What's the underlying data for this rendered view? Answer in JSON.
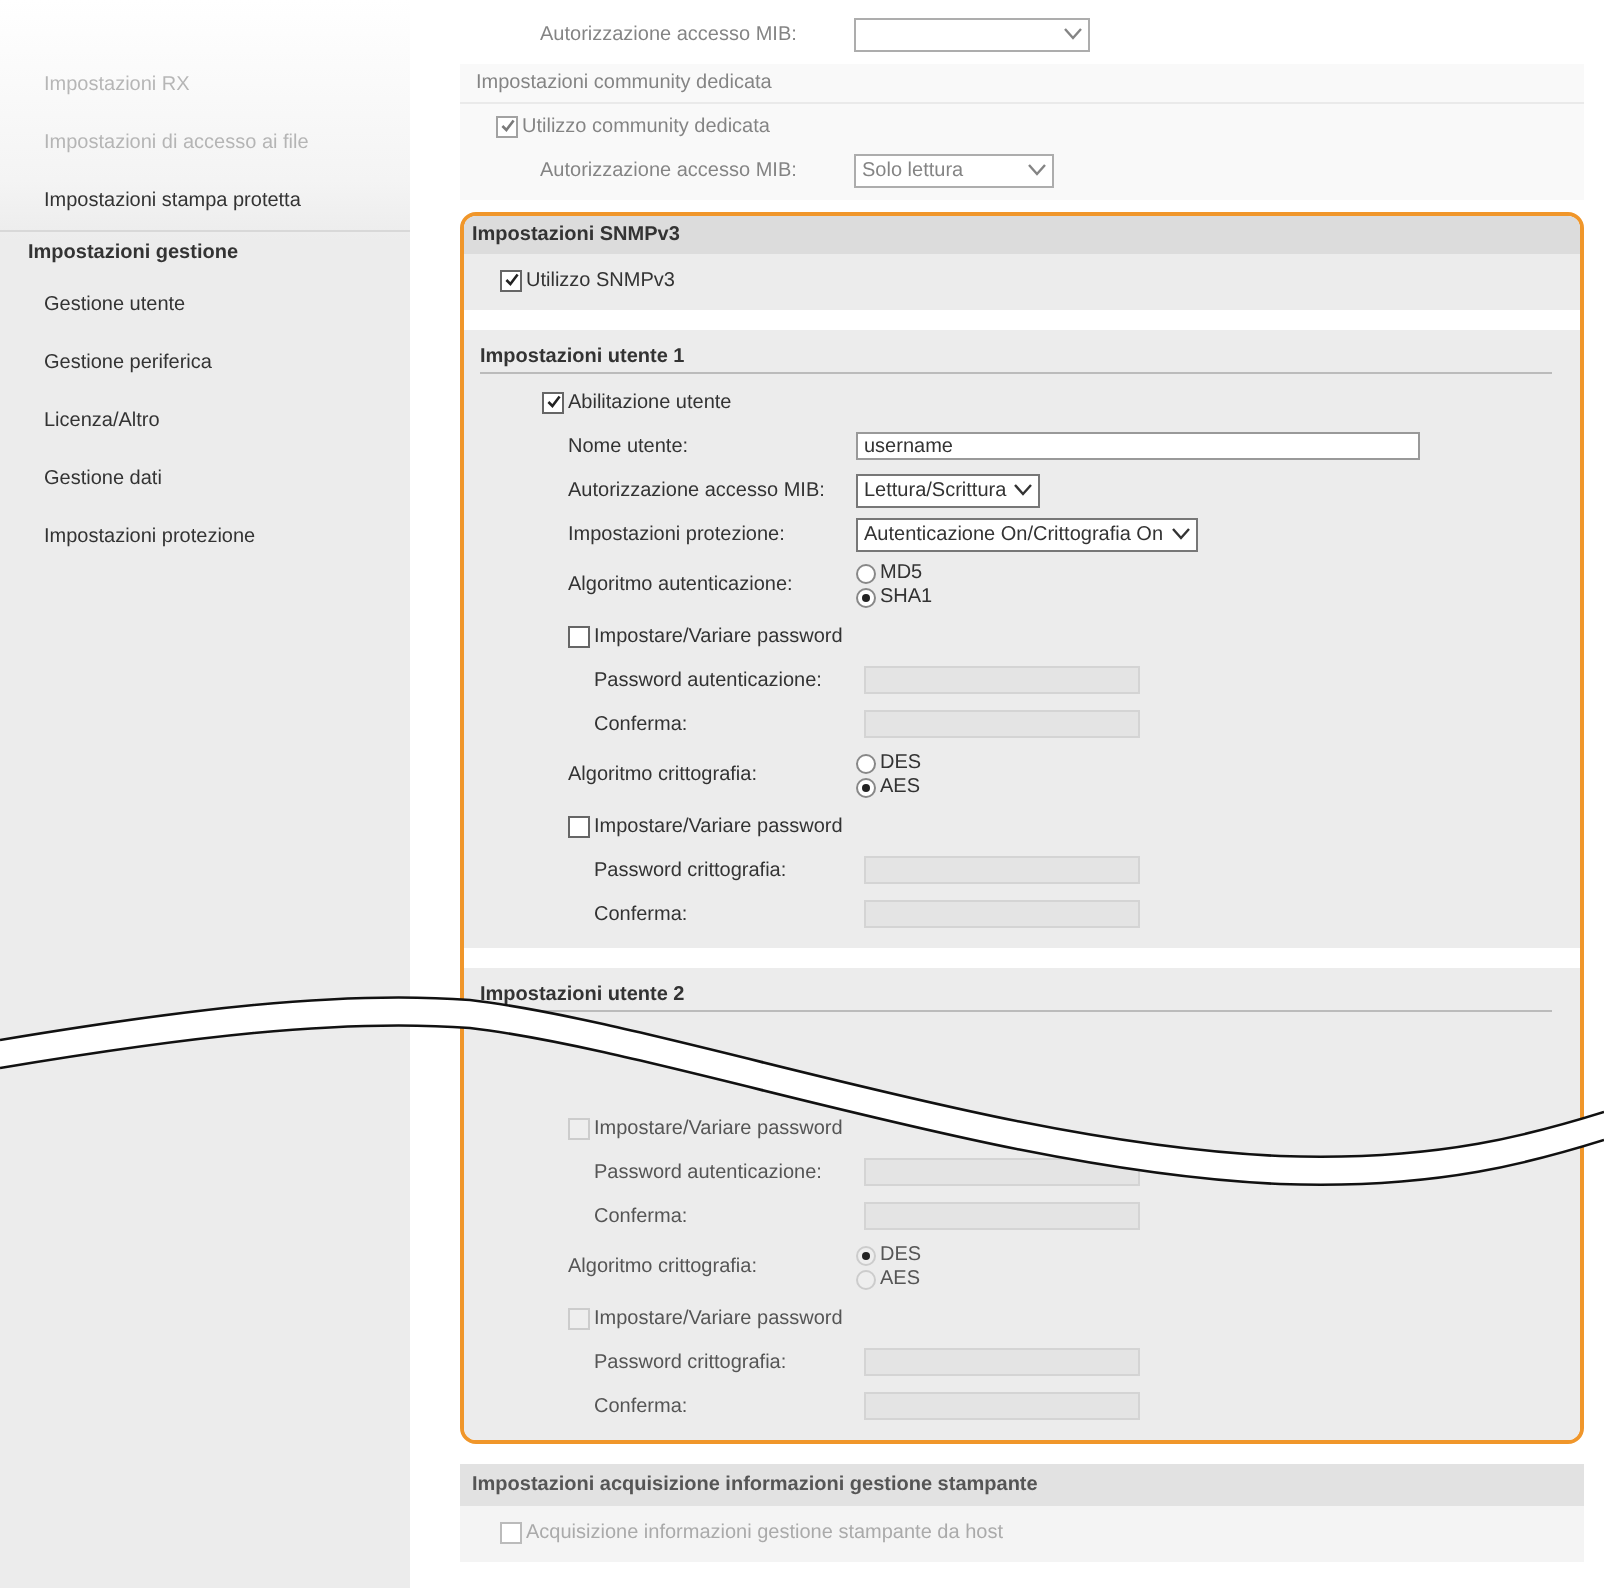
{
  "sidebar": {
    "items": [
      {
        "label": "Impostazioni RX",
        "kind": "item",
        "faded": true
      },
      {
        "label": "Impostazioni di accesso ai file",
        "kind": "item",
        "faded": true
      },
      {
        "label": "Impostazioni stampa protetta",
        "kind": "item",
        "faded": false
      },
      {
        "label": "Impostazioni gestione",
        "kind": "header",
        "faded": false
      },
      {
        "label": "Gestione utente",
        "kind": "item",
        "faded": false
      },
      {
        "label": "Gestione periferica",
        "kind": "item",
        "faded": false
      },
      {
        "label": "Licenza/Altro",
        "kind": "item",
        "faded": false
      },
      {
        "label": "Gestione dati",
        "kind": "item",
        "faded": false
      },
      {
        "label": "Impostazioni protezione",
        "kind": "item",
        "faded": false
      }
    ]
  },
  "snmpv1": {
    "faded": true,
    "mib_label": "Autorizzazione accesso MIB:",
    "community": {
      "title": "Impostazioni community dedicata",
      "checkbox": {
        "label": "Utilizzo community dedicata",
        "checked": true
      },
      "mib": {
        "label": "Autorizzazione accesso MIB:",
        "value": "Solo lettura"
      }
    }
  },
  "snmpv3": {
    "title": "Impostazioni SNMPv3",
    "checkbox": {
      "label": "Utilizzo SNMPv3",
      "checked": true
    },
    "users": [
      {
        "title": "Impostazioni utente 1",
        "disabled": false,
        "cut": false,
        "rows": [
          {
            "kind": "checkbox",
            "label": "Abilitazione utente",
            "checked": true,
            "children": [
              {
                "kind": "text",
                "label": "Nome utente:",
                "value": "username"
              },
              {
                "kind": "select",
                "label": "Autorizzazione accesso MIB:",
                "value": "Lettura/Scrittura"
              },
              {
                "kind": "select",
                "label": "Impostazioni protezione:",
                "value": "Autenticazione On/Crittografia On"
              },
              {
                "kind": "radio",
                "label": "Algoritmo autenticazione:",
                "options": [
                  {
                    "label": "MD5",
                    "selected": false
                  },
                  {
                    "label": "SHA1",
                    "selected": true
                  }
                ]
              },
              {
                "kind": "checkbox",
                "label": "Impostare/Variare password",
                "checked": false,
                "children": [
                  {
                    "kind": "password",
                    "label": "Password autenticazione:"
                  },
                  {
                    "kind": "password",
                    "label": "Conferma:"
                  }
                ]
              },
              {
                "kind": "radio",
                "label": "Algoritmo crittografia:",
                "options": [
                  {
                    "label": "DES",
                    "selected": false
                  },
                  {
                    "label": "AES",
                    "selected": true
                  }
                ]
              },
              {
                "kind": "checkbox",
                "label": "Impostare/Variare password",
                "checked": false,
                "children": [
                  {
                    "kind": "password",
                    "label": "Password crittografia:"
                  },
                  {
                    "kind": "password",
                    "label": "Conferma:"
                  }
                ]
              }
            ]
          }
        ]
      },
      {
        "title": "Impostazioni utente 2",
        "disabled": true,
        "cut": true,
        "rows": [
          {
            "kind": "checkbox",
            "label": "Impostare/Variare password",
            "checked": false,
            "children": [
              {
                "kind": "password",
                "label": "Password autenticazione:"
              },
              {
                "kind": "password",
                "label": "Conferma:"
              }
            ]
          },
          {
            "kind": "radio",
            "label": "Algoritmo crittografia:",
            "options": [
              {
                "label": "DES",
                "selected": true
              },
              {
                "label": "AES",
                "selected": false
              }
            ]
          },
          {
            "kind": "checkbox",
            "label": "Impostare/Variare password",
            "checked": false,
            "children": [
              {
                "kind": "password",
                "label": "Password crittografia:"
              },
              {
                "kind": "password",
                "label": "Conferma:"
              }
            ]
          }
        ]
      }
    ]
  },
  "host_section": {
    "title": "Impostazioni acquisizione informazioni gestione stampante",
    "checkbox": {
      "label": "Acquisizione informazioni gestione stampante da host",
      "checked": false,
      "disabled": true
    }
  }
}
